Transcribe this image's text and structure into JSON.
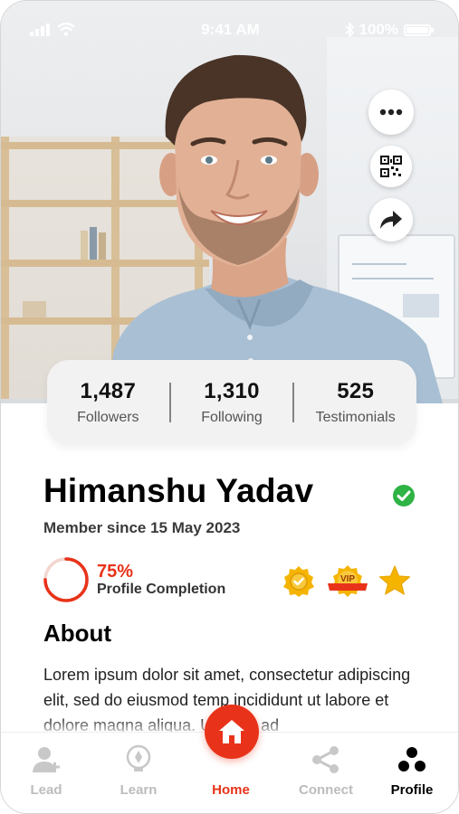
{
  "status_bar": {
    "time": "9:41 AM",
    "battery": "100%"
  },
  "stats": [
    {
      "value": "1,487",
      "label": "Followers"
    },
    {
      "value": "1,310",
      "label": "Following"
    },
    {
      "value": "525",
      "label": "Testimonials"
    }
  ],
  "profile": {
    "name": "Himanshu Yadav",
    "member_since": "Member since 15 May 2023",
    "completion_percent": "75%",
    "completion_value": 0.75,
    "completion_label": "Profile Completion",
    "vip_badge": "VIP"
  },
  "about": {
    "title": "About",
    "text": "Lorem ipsum dolor sit amet, consectetur adipiscing elit, sed do eiusmod temp incididunt ut labore et dolore magna aliqua. Ut enim ad"
  },
  "nav": {
    "items": [
      {
        "label": "Lead",
        "icon": "user-icon"
      },
      {
        "label": "Learn",
        "icon": "bulb-icon"
      },
      {
        "label": "Home",
        "icon": "home-icon"
      },
      {
        "label": "Connect",
        "icon": "share-icon"
      },
      {
        "label": "Profile",
        "icon": "profile-dots-icon"
      }
    ]
  },
  "colors": {
    "accent": "#e8331a",
    "verified": "#2fb344",
    "gold": "#f5b400",
    "card_bg": "#f2f2f3"
  }
}
